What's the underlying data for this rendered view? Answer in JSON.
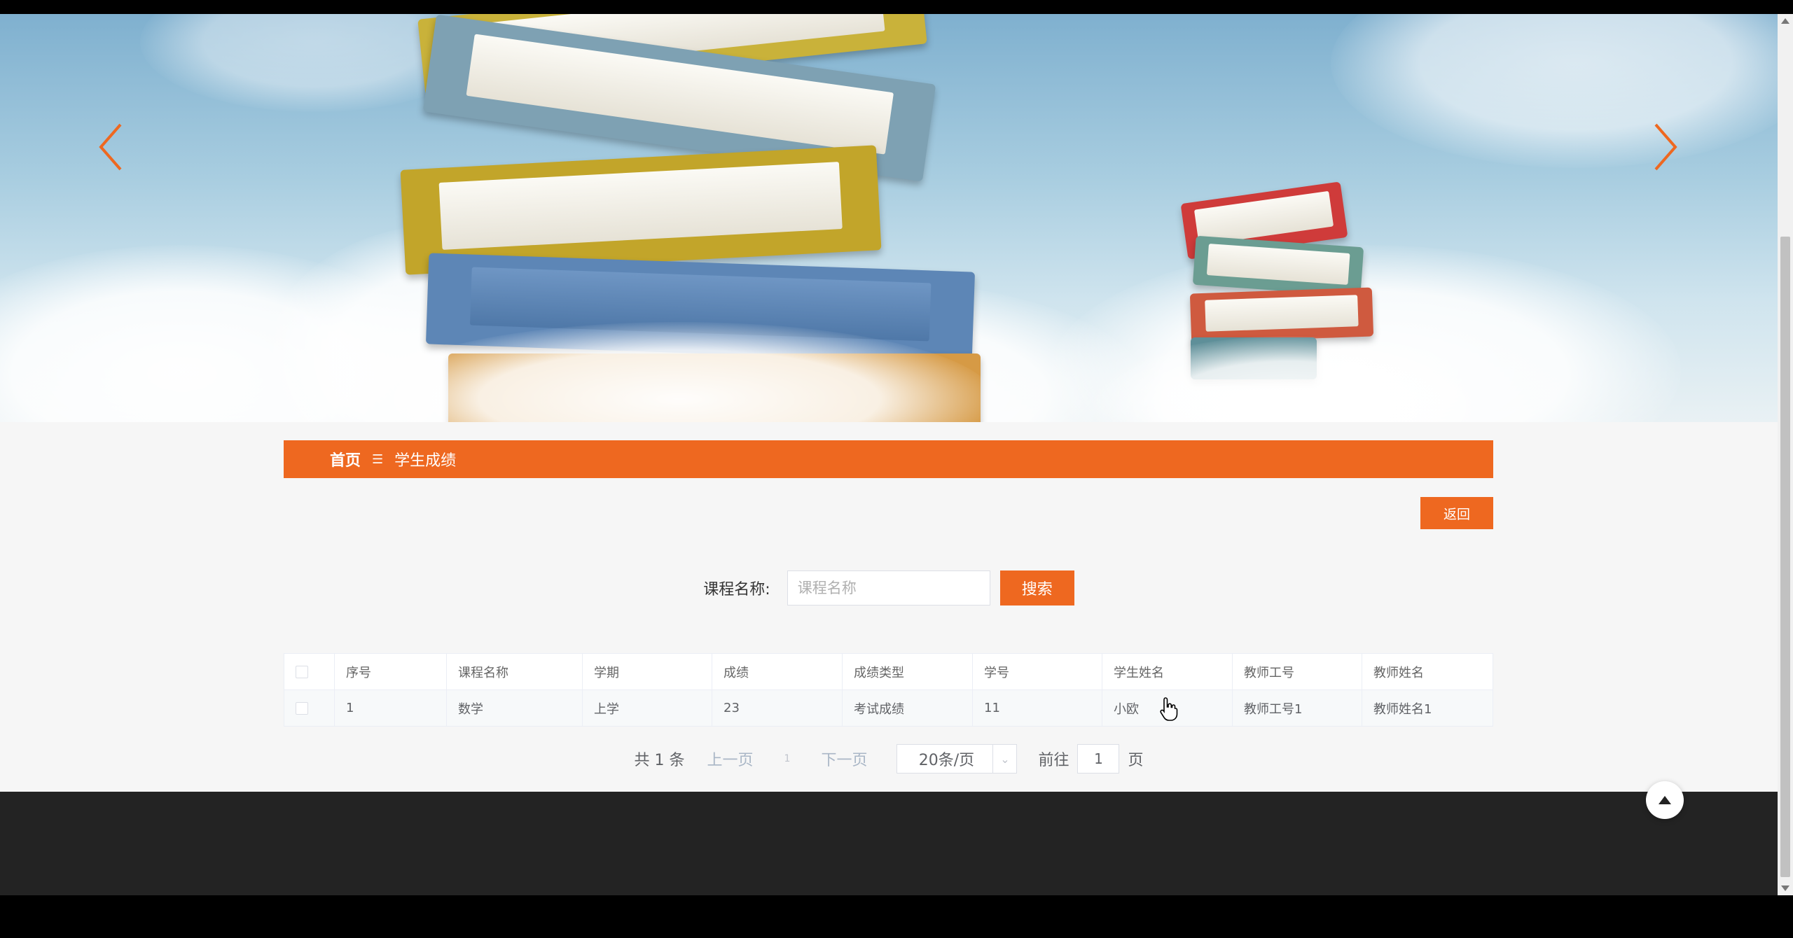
{
  "colors": {
    "accent": "#ee6820",
    "footer": "#232323",
    "page_bg": "#f6f6f6"
  },
  "banner": {
    "prev_icon": "chevron-left-icon",
    "next_icon": "chevron-right-icon"
  },
  "breadcrumb": {
    "home": "首页",
    "separator": "☰",
    "current": "学生成绩"
  },
  "toolbar": {
    "back_label": "返回"
  },
  "search": {
    "label": "课程名称:",
    "placeholder": "课程名称",
    "value": "",
    "button_label": "搜索"
  },
  "table": {
    "columns": [
      "序号",
      "课程名称",
      "学期",
      "成绩",
      "成绩类型",
      "学号",
      "学生姓名",
      "教师工号",
      "教师姓名"
    ],
    "rows": [
      {
        "index": "1",
        "course": "数学",
        "term": "上学",
        "score": "23",
        "score_type": "考试成绩",
        "student_no": "11",
        "student_name": "小欧",
        "teacher_no": "教师工号1",
        "teacher_name": "教师姓名1"
      }
    ]
  },
  "pagination": {
    "total": "共 1 条",
    "prev": "上一页",
    "current_page": "1",
    "next": "下一页",
    "page_size": "20条/页",
    "goto_label": "前往",
    "goto_value": "1",
    "goto_suffix": "页"
  },
  "back_to_top_icon": "arrow-up-icon"
}
